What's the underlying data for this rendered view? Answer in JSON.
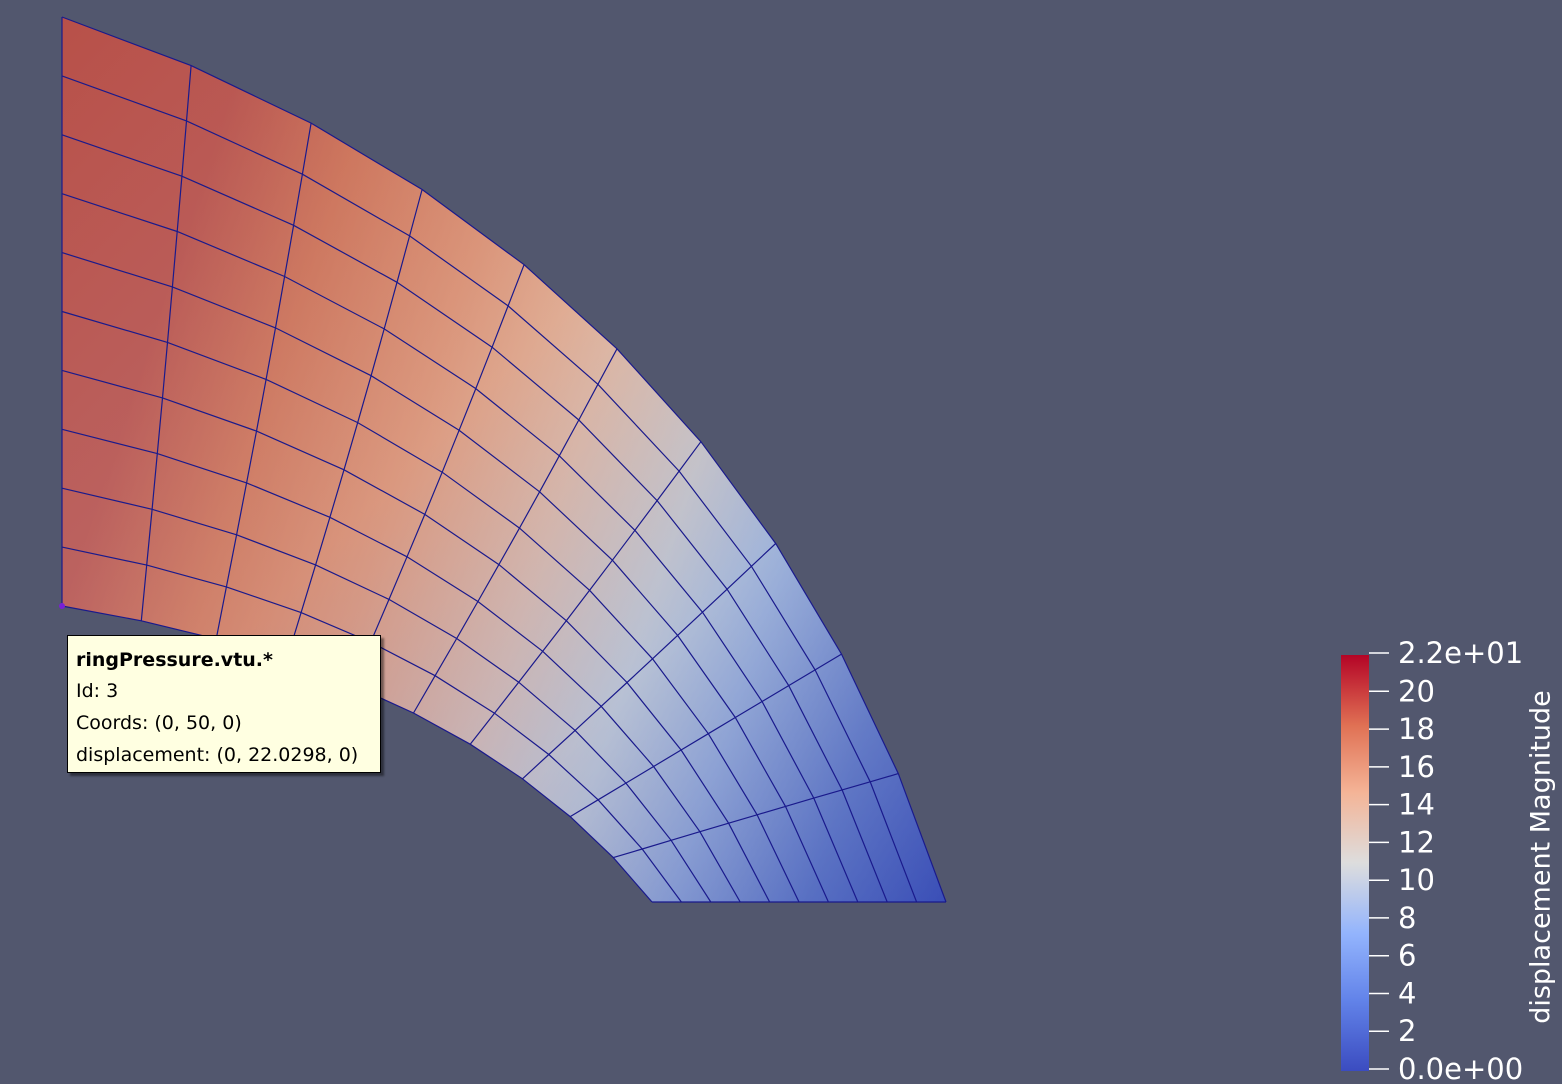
{
  "colors": {
    "background": "#52576e",
    "mesh_lines": "#1a1a8c",
    "tooltip_bg": "#ffffe1",
    "colormap": [
      "#3b4cc0",
      "#6f91f2",
      "#aac7fd",
      "#dddddd",
      "#f6b89c",
      "#e57358",
      "#b40426"
    ],
    "colormap_name": "Cool to Warm"
  },
  "tooltip": {
    "title": "ringPressure.vtu.*",
    "id": "Id: 3",
    "coords": "Coords: (0, 50, 0)",
    "displacement": "displacement: (0, 22.0298, 0)"
  },
  "legend": {
    "title": "displacement Magnitude",
    "range": [
      0,
      22.0298
    ],
    "tick_values": [
      0,
      2,
      4,
      6,
      8,
      10,
      12,
      14,
      16,
      18,
      20,
      22.0298
    ],
    "tick_labels": [
      "0.0e+00",
      "2",
      "4",
      "6",
      "8",
      "10",
      "12",
      "14",
      "16",
      "18",
      "20",
      "2.2e+01"
    ]
  },
  "mesh": {
    "angular_divisions": 10,
    "radial_divisions": 10,
    "selected_point": "Id: 3"
  }
}
